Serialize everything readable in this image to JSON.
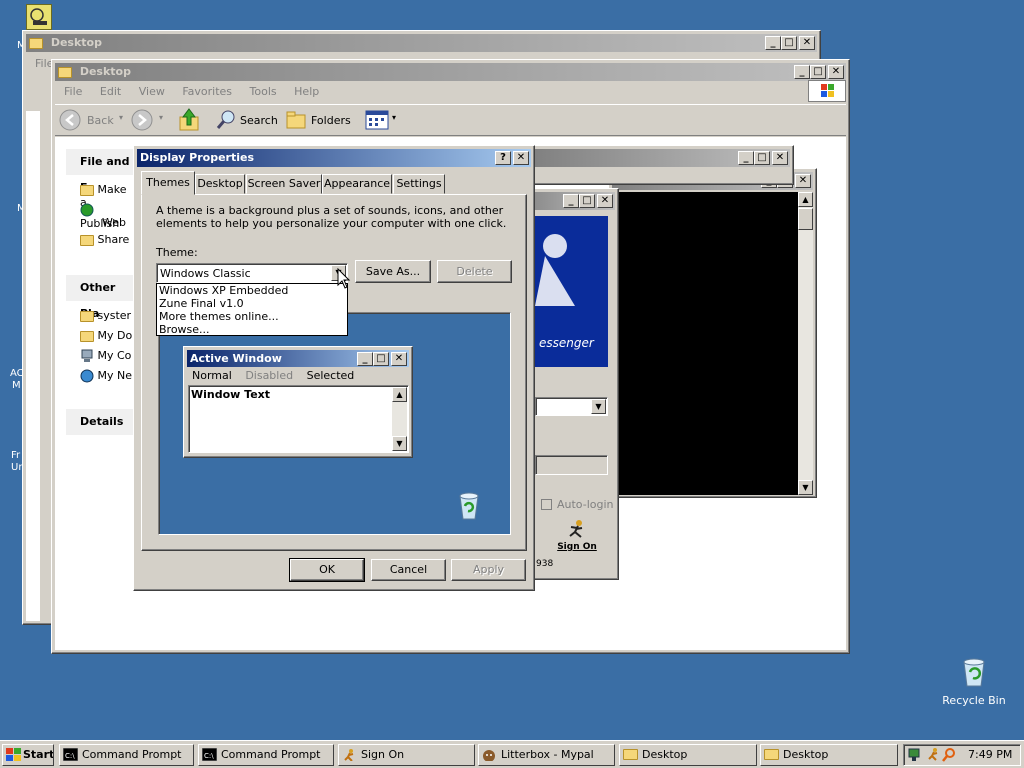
{
  "desktop": {
    "recycle_bin_label": "Recycle Bin",
    "left_icon_fragments": [
      "M",
      "M",
      "AC",
      "M",
      "Fr",
      "Un"
    ]
  },
  "win_back": {
    "title": "Desktop",
    "menu_first": "File"
  },
  "explorer": {
    "title": "Desktop",
    "menu": [
      "File",
      "Edit",
      "View",
      "Favorites",
      "Tools",
      "Help"
    ],
    "toolbar": {
      "back": "Back",
      "search": "Search",
      "folders": "Folders"
    },
    "panels": {
      "file_tasks_title": "File and F",
      "file_tasks": [
        "Make a",
        "Publish",
        "Web",
        "Share"
      ],
      "other_places_title": "Other Pla",
      "other_places": [
        "syster",
        "My Do",
        "My Co",
        "My Ne"
      ],
      "details_title": "Details"
    }
  },
  "messenger": {
    "banner_text": "essenger",
    "auto_login_label": "Auto-login",
    "sign_on_label": "Sign On",
    "fragment": "938"
  },
  "display_properties": {
    "title": "Display Properties",
    "tabs": [
      "Themes",
      "Desktop",
      "Screen Saver",
      "Appearance",
      "Settings"
    ],
    "description": "A theme is a background plus a set of sounds, icons, and other elements to help you personalize your computer with one click.",
    "theme_label": "Theme:",
    "theme_selected": "Windows Classic",
    "theme_options": [
      "Windows XP Embedded",
      "Zune Final v1.0",
      "More themes online...",
      "Browse..."
    ],
    "save_as_label": "Save As...",
    "delete_label": "Delete",
    "preview": {
      "active_window_title": "Active Window",
      "menu_items": [
        "Normal",
        "Disabled",
        "Selected"
      ],
      "window_text": "Window Text"
    },
    "ok_label": "OK",
    "cancel_label": "Cancel",
    "apply_label": "Apply"
  },
  "taskbar": {
    "start_label": "Start",
    "buttons": [
      "Command Prompt",
      "Command Prompt",
      "Sign On",
      "Litterbox - Mypal",
      "Desktop",
      "Desktop"
    ],
    "clock": "7:49 PM"
  },
  "colors": {
    "desktop_bg": "#3a6ea5",
    "active_title": "#0a246a",
    "messenger_blue": "#0a2c9a"
  }
}
